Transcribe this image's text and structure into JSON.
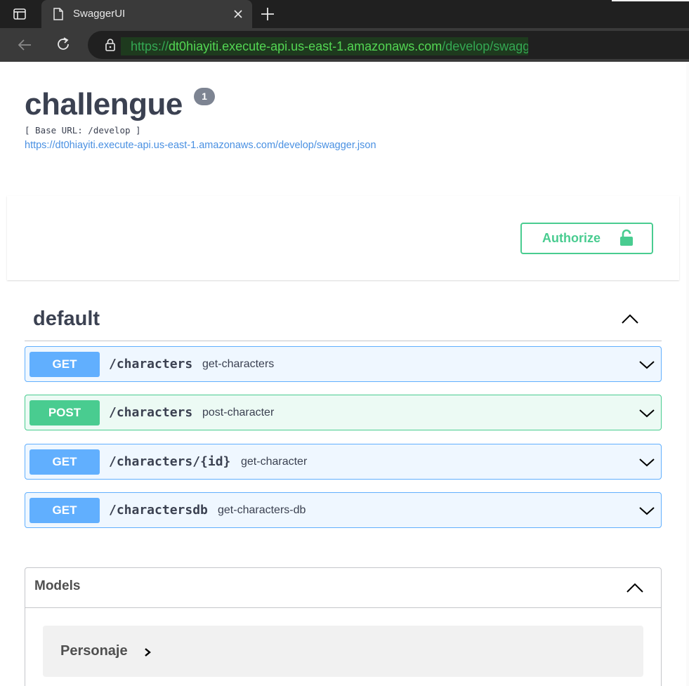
{
  "browser": {
    "tab_title": "SwaggerUI",
    "url_scheme": "https://",
    "url_host": "dt0hiayiti.execute-api.us-east-1.amazonaws.com",
    "url_path": "/develop/swagger"
  },
  "info": {
    "title": "challengue",
    "version": "1",
    "base_url": "[ Base URL: /develop ]",
    "spec_url": "https://dt0hiayiti.execute-api.us-east-1.amazonaws.com/develop/swagger.json"
  },
  "authorize": {
    "label": "Authorize"
  },
  "tag": {
    "name": "default"
  },
  "operations": [
    {
      "method": "GET",
      "path": "/characters",
      "summary": "get-characters"
    },
    {
      "method": "POST",
      "path": "/characters",
      "summary": "post-character"
    },
    {
      "method": "GET",
      "path": "/characters/{id}",
      "summary": "get-character"
    },
    {
      "method": "GET",
      "path": "/charactersdb",
      "summary": "get-characters-db"
    }
  ],
  "models": {
    "title": "Models",
    "items": [
      "Personaje"
    ]
  },
  "colors": {
    "get": "#61affe",
    "post": "#49cc90",
    "text": "#3b4151",
    "link": "#4990e2"
  },
  "icons": {
    "sidebar_toggle": "sidebar-icon",
    "tab_doc": "document-icon",
    "tab_close": "close-icon",
    "new_tab": "plus-icon",
    "back": "back-arrow-icon",
    "reload": "reload-icon",
    "lock": "lock-icon",
    "authorize": "unlock-icon",
    "collapse": "chevron-up-icon",
    "expand": "chevron-down-icon",
    "model_expand": "chevron-right-icon"
  }
}
